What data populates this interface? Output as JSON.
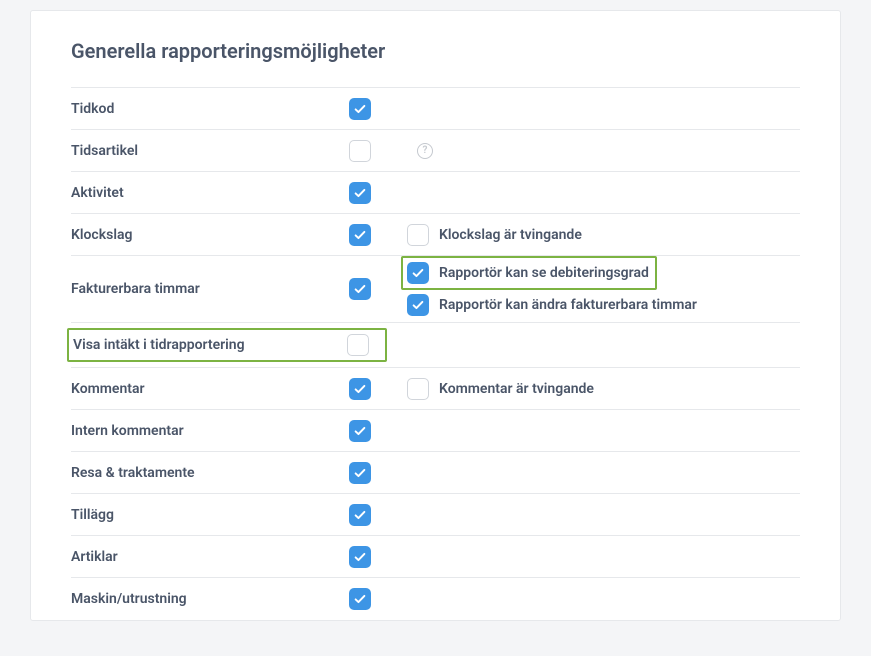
{
  "section": {
    "title": "Generella rapporteringsmöjligheter"
  },
  "rows": {
    "tidkod": {
      "label": "Tidkod"
    },
    "tidsartikel": {
      "label": "Tidsartikel"
    },
    "aktivitet": {
      "label": "Aktivitet"
    },
    "klockslag": {
      "label": "Klockslag",
      "extra_label": "Klockslag är tvingande"
    },
    "fakturerbara": {
      "label": "Fakturerbara timmar",
      "extra1": "Rapportör kan se debiteringsgrad",
      "extra2": "Rapportör kan ändra fakturerbara timmar"
    },
    "visa_intakt": {
      "label": "Visa intäkt i tidrapportering"
    },
    "kommentar": {
      "label": "Kommentar",
      "extra_label": "Kommentar är tvingande"
    },
    "intern_kommentar": {
      "label": "Intern kommentar"
    },
    "resa": {
      "label": "Resa & traktamente"
    },
    "tillagg": {
      "label": "Tillägg"
    },
    "artiklar": {
      "label": "Artiklar"
    },
    "maskin": {
      "label": "Maskin/utrustning"
    }
  }
}
